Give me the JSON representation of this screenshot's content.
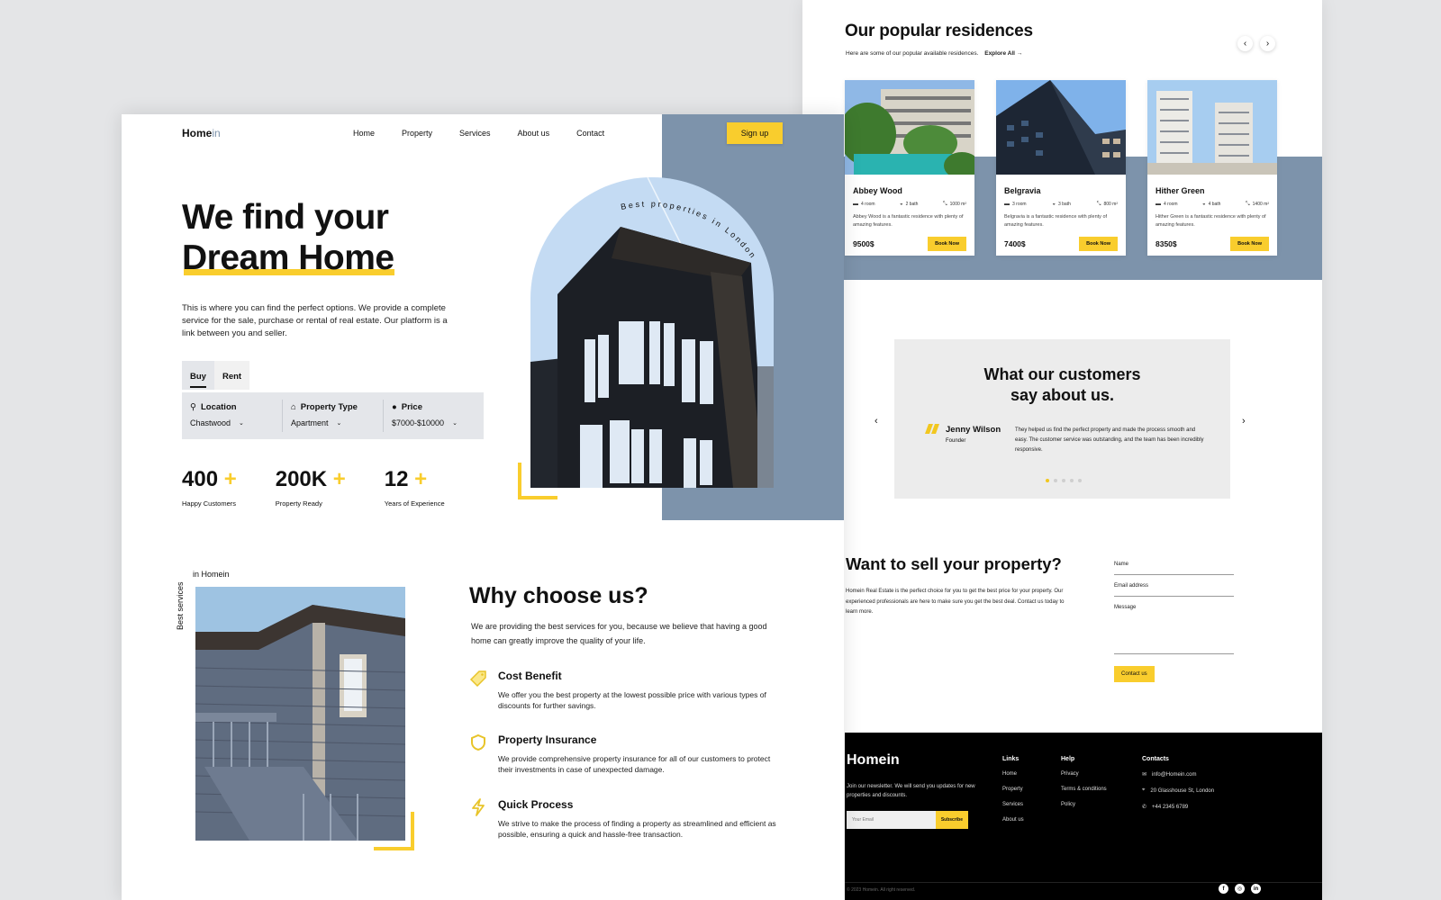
{
  "brand": {
    "name_main": "Home",
    "name_accent": "in",
    "accent_color": "#f9cd2d",
    "panel_color": "#7d93ab"
  },
  "nav": {
    "items": [
      "Home",
      "Property",
      "Services",
      "About us",
      "Contact"
    ],
    "signup_label": "Sign up"
  },
  "hero": {
    "title_line1": "We find your",
    "title_line2": "Dream Home",
    "text": "This is where you can find the perfect options. We provide a complete service for the sale, purchase or rental of real estate. Our platform is a link between you and seller.",
    "curved_text": "Best properties in London"
  },
  "search": {
    "tabs": [
      "Buy",
      "Rent"
    ],
    "active_tab": "Buy",
    "fields": [
      {
        "label": "Location",
        "value": "Chastwood",
        "icon": "map-pin-icon"
      },
      {
        "label": "Property Type",
        "value": "Apartment",
        "icon": "home-icon"
      },
      {
        "label": "Price",
        "value": "$7000-$10000",
        "icon": "dollar-icon"
      }
    ]
  },
  "stats": [
    {
      "number": "400",
      "suffix": "+",
      "label": "Happy Customers"
    },
    {
      "number": "200K",
      "suffix": "+",
      "label": "Property Ready"
    },
    {
      "number": "12",
      "suffix": "+",
      "label": "Years of Experience"
    }
  ],
  "why": {
    "vertical_label": "Best services",
    "horizontal_label": "in Homein",
    "title": "Why choose us?",
    "text": "We are providing the best services for you, because we believe that having a good home can greatly improve the quality of your life.",
    "features": [
      {
        "title": "Cost Benefit",
        "text": "We offer you the best property at the lowest possible price with various types of discounts for further savings.",
        "icon": "price-tag-icon"
      },
      {
        "title": "Property Insurance",
        "text": "We provide comprehensive property insurance for all of our customers to protect their investments in case of unexpected damage.",
        "icon": "shield-icon"
      },
      {
        "title": "Quick Process",
        "text": "We strive to make the process of finding a property as streamlined and efficient as possible, ensuring a quick and hassle-free transaction.",
        "icon": "lightning-icon"
      }
    ]
  },
  "popular": {
    "title": "Our popular residences",
    "subtitle": "Here are some of our popular available residences.",
    "explore_label": "Explore All →",
    "prev": "‹",
    "next": "›",
    "cards": [
      {
        "name": "Abbey Wood",
        "rooms": "4 room",
        "baths": "2 bath",
        "area": "1000 m²",
        "desc": "Abbey Wood is a fantastic residence with plenty of amazing features.",
        "price": "9500$",
        "button": "Book Now"
      },
      {
        "name": "Belgravia",
        "rooms": "3 room",
        "baths": "3 bath",
        "area": "800 m²",
        "desc": "Belgravia is a fantastic residence with plenty of amazing features.",
        "price": "7400$",
        "button": "Book Now"
      },
      {
        "name": "Hither Green",
        "rooms": "4 room",
        "baths": "4 bath",
        "area": "1400 m²",
        "desc": "Hither Green is a fantastic residence with plenty of amazing features.",
        "price": "8350$",
        "button": "Book Now"
      }
    ]
  },
  "testimonial": {
    "title_line1": "What our customers",
    "title_line2": "say about us.",
    "name": "Jenny Wilson",
    "role": "Founder",
    "text": "They helped us find the perfect property and made the process smooth and easy. The customer service was outstanding, and the team has been incredibly responsive.",
    "slides": 5,
    "active_slide": 1,
    "prev": "‹",
    "next": "›"
  },
  "sell": {
    "title": "Want to sell your property?",
    "text": "Homein Real Estate is the perfect choice for you to get the best price for your property. Our experienced professionals are here to make sure you get the best deal. Contact us today to learn more.",
    "fields": {
      "name": "Name",
      "email": "Email address",
      "message": "Message"
    },
    "button": "Contact us"
  },
  "footer": {
    "logo": "Homein",
    "newsletter": "Join our newsletter. We will send you updates for new properties and discounts.",
    "email_placeholder": "Your Email",
    "subscribe": "Subscribe",
    "links": {
      "heading": "Links",
      "items": [
        "Home",
        "Property",
        "Services",
        "About us"
      ]
    },
    "help": {
      "heading": "Help",
      "items": [
        "Privacy",
        "Terms & conditions",
        "Policy"
      ]
    },
    "contacts": {
      "heading": "Contacts",
      "email": "info@Homein.com",
      "address": "20 Glasshouse St, London",
      "phone": "+44 2345 6789"
    },
    "copyright": "© 2023 Homein. All right reserved.",
    "socials": [
      "f",
      "ig",
      "in"
    ]
  }
}
